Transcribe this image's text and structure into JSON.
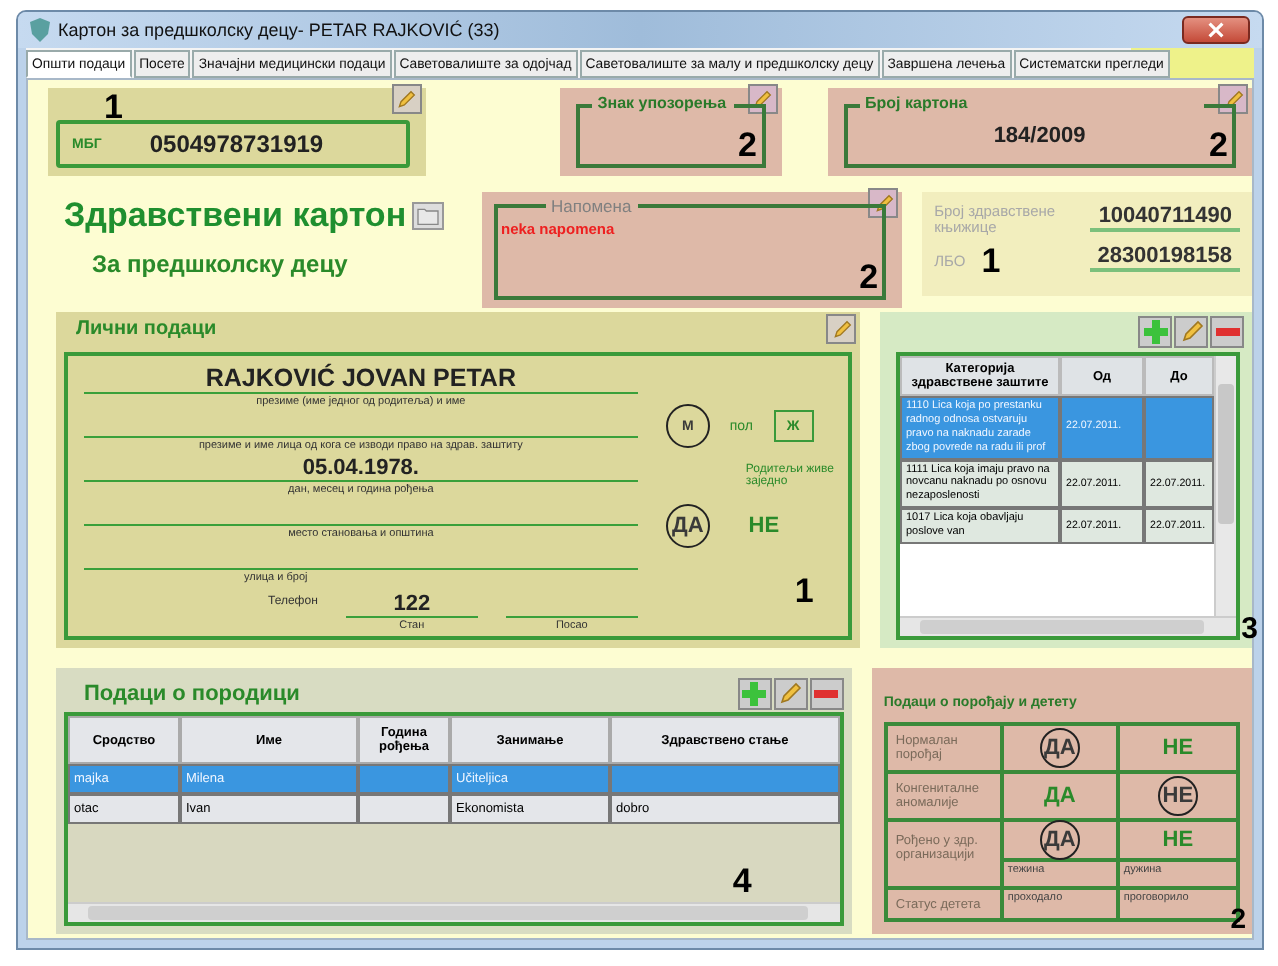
{
  "window": {
    "title": "Картон за предшколску децу- PETAR RAJKOVIĆ  (33)"
  },
  "tabs": [
    {
      "label": "Општи подаци",
      "selected": true
    },
    {
      "label": "Посете",
      "selected": false
    },
    {
      "label": "Значајни медицински подаци",
      "selected": false
    },
    {
      "label": "Саветовалиште за одојчад",
      "selected": false
    },
    {
      "label": "Саветовалиште за малу и предшколску децу",
      "selected": false
    },
    {
      "label": "Завршена лечења",
      "selected": false
    },
    {
      "label": "Систематски прегледи",
      "selected": false
    }
  ],
  "mbg": {
    "label": "МБГ",
    "value": "0504978731919",
    "marker": "1"
  },
  "warning_sign": {
    "label": "Знак упозорења",
    "marker": "2"
  },
  "card_number": {
    "label": "Број картона",
    "value": "184/2009",
    "marker": "2"
  },
  "heading": {
    "title": "Здравствени картон",
    "subtitle": "За предшколску децу"
  },
  "note": {
    "label": "Напомена",
    "value": "neka napomena",
    "marker": "2"
  },
  "ids": {
    "booklet_label": "Број здравствене књижице",
    "booklet_value": "10040711490",
    "lbo_label": "ЛБО",
    "lbo_value": "28300198158",
    "marker": "1"
  },
  "personal": {
    "title": "Лични подаци",
    "name": "RAJKOVIĆ JOVAN PETAR",
    "name_caption": "презиме (име једног од родитеља) и име",
    "insured_caption": "презиме и име лица од кога се изводи право на здрав. заштиту",
    "birth_date": "05.04.1978.",
    "birth_caption": "дан, месец и година рођења",
    "residence_caption": "место становања и општина",
    "street_caption": "улица и број",
    "phone_label": "Телефон",
    "phone_home": "122",
    "home_caption": "Стан",
    "work_caption": "Посао",
    "sex_label": "пол",
    "sex_options": [
      {
        "label": "М",
        "selected": true
      },
      {
        "label": "Ж",
        "selected": false
      }
    ],
    "parents_label": "Родитељи живе заједно",
    "parents_options": [
      {
        "label": "ДА",
        "selected": true
      },
      {
        "label": "НЕ",
        "selected": false
      }
    ],
    "marker": "1"
  },
  "protection": {
    "columns": [
      "Категорија здравствене заштите",
      "Од",
      "До"
    ],
    "rows": [
      {
        "category": "1110 Lica koja po prestanku radnog odnosa ostvaruju pravo na naknadu zarade zbog povrede na radu ili prof",
        "from": "22.07.2011.",
        "selected": true
      },
      {
        "category": "1111 Lica koja imaju pravo na novcanu naknadu po osnovu nezaposlenosti",
        "from": "22.07.2011.",
        "to": "22.07.2011.",
        "selected": false
      },
      {
        "category": "1017 Lica koja obavljaju poslove van",
        "from": "22.07.2011.",
        "to": "22.07.2011.",
        "selected": false
      }
    ],
    "marker": "3"
  },
  "family": {
    "title": "Подаци о породици",
    "columns": [
      "Сродство",
      "Име",
      "Година рођења",
      "Занимање",
      "Здравствено стање"
    ],
    "rows": [
      {
        "relation": "majka",
        "name": "Milena",
        "occupation": "Učiteljica",
        "selected": true
      },
      {
        "relation": "otac",
        "name": "Ivan",
        "occupation": "Ekonomista",
        "health": "dobro",
        "selected": false
      }
    ],
    "marker": "4"
  },
  "birth": {
    "title": "Подаци о порођају и детету",
    "rows": [
      {
        "label": "Нормалан порођај",
        "options": [
          {
            "label": "ДА",
            "selected": true
          },
          {
            "label": "НЕ",
            "selected": false
          }
        ]
      },
      {
        "label": "Конгениталне аномалије",
        "options": [
          {
            "label": "ДА",
            "selected": false
          },
          {
            "label": "НЕ",
            "selected": true
          }
        ]
      },
      {
        "label": "Рођено у здр. организацији",
        "options": [
          {
            "label": "ДА",
            "selected": true
          },
          {
            "label": "НЕ",
            "selected": false
          }
        ]
      }
    ],
    "weight_label": "тежина",
    "length_label": "дужина",
    "status_label": "Статус детета",
    "status_walk": "проходало",
    "status_talk": "проговорило",
    "marker": "2"
  }
}
